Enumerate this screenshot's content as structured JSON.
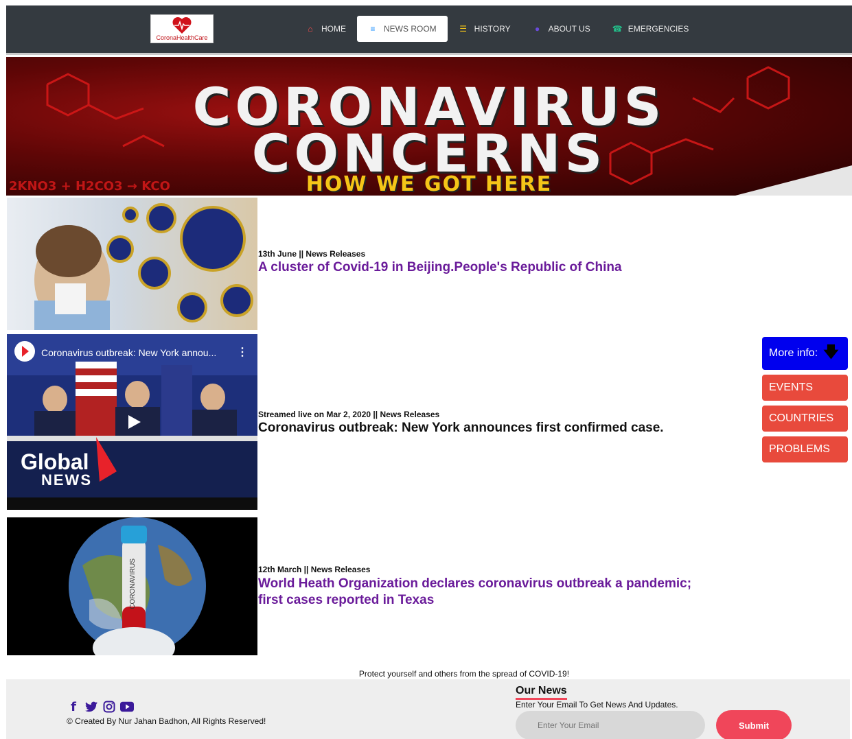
{
  "nav": {
    "logo_text": "CoronaHealthCare",
    "items": [
      {
        "label": "HOME",
        "icon": "home-icon",
        "glyph": "⌂",
        "color": "#ff4d4d"
      },
      {
        "label": "NEWS ROOM",
        "icon": "news-icon",
        "glyph": "≡",
        "color": "#1e90ff",
        "active": true
      },
      {
        "label": "HISTORY",
        "icon": "layers-icon",
        "glyph": "☰",
        "color": "#f5c518"
      },
      {
        "label": "ABOUT US",
        "icon": "users-icon",
        "glyph": "●",
        "color": "#6a4bdc"
      },
      {
        "label": "EMERGENCIES",
        "icon": "headset-icon",
        "glyph": "☎",
        "color": "#22c08a"
      }
    ]
  },
  "banner": {
    "line1": "CORONAVIRUS",
    "line2": "CONCERNS",
    "line3": "HOW WE GOT HERE",
    "formula": "2KNO3 + H2CO3 → KCO"
  },
  "news": [
    {
      "meta": "13th June || News Releases",
      "title": "A cluster of Covid-19 in Beijing.People's Republic of China"
    },
    {
      "meta": "Streamed live on Mar 2, 2020 || News Releases",
      "title": "Coronavirus outbreak: New York announces first confirmed case.",
      "video_title": "Coronavirus outbreak: New York annou...",
      "brand_line1": "Global",
      "brand_line2": "NEWS"
    },
    {
      "meta": "12th March || News Releases",
      "title_line1": "World Heath Organization declares coronavirus outbreak a pandemic;",
      "title_line2": "first cases reported in Texas",
      "tube_label": "CORONAVIRUS"
    }
  ],
  "side": {
    "more": "More info:",
    "events": "EVENTS",
    "countries": "COUNTRIES",
    "problems": "PROBLEMS"
  },
  "footer": {
    "protect": "Protect yourself and others from the spread of COVID-19!",
    "copyright": "© Created By Nur Jahan Badhon, All Rights Reserved!",
    "our_news": "Our News",
    "subscribe_text": "Enter Your Email To Get News And Updates.",
    "email_placeholder": "Enter Your Email",
    "submit": "Submit",
    "socials": [
      "facebook-icon",
      "twitter-icon",
      "instagram-icon",
      "youtube-icon"
    ]
  }
}
